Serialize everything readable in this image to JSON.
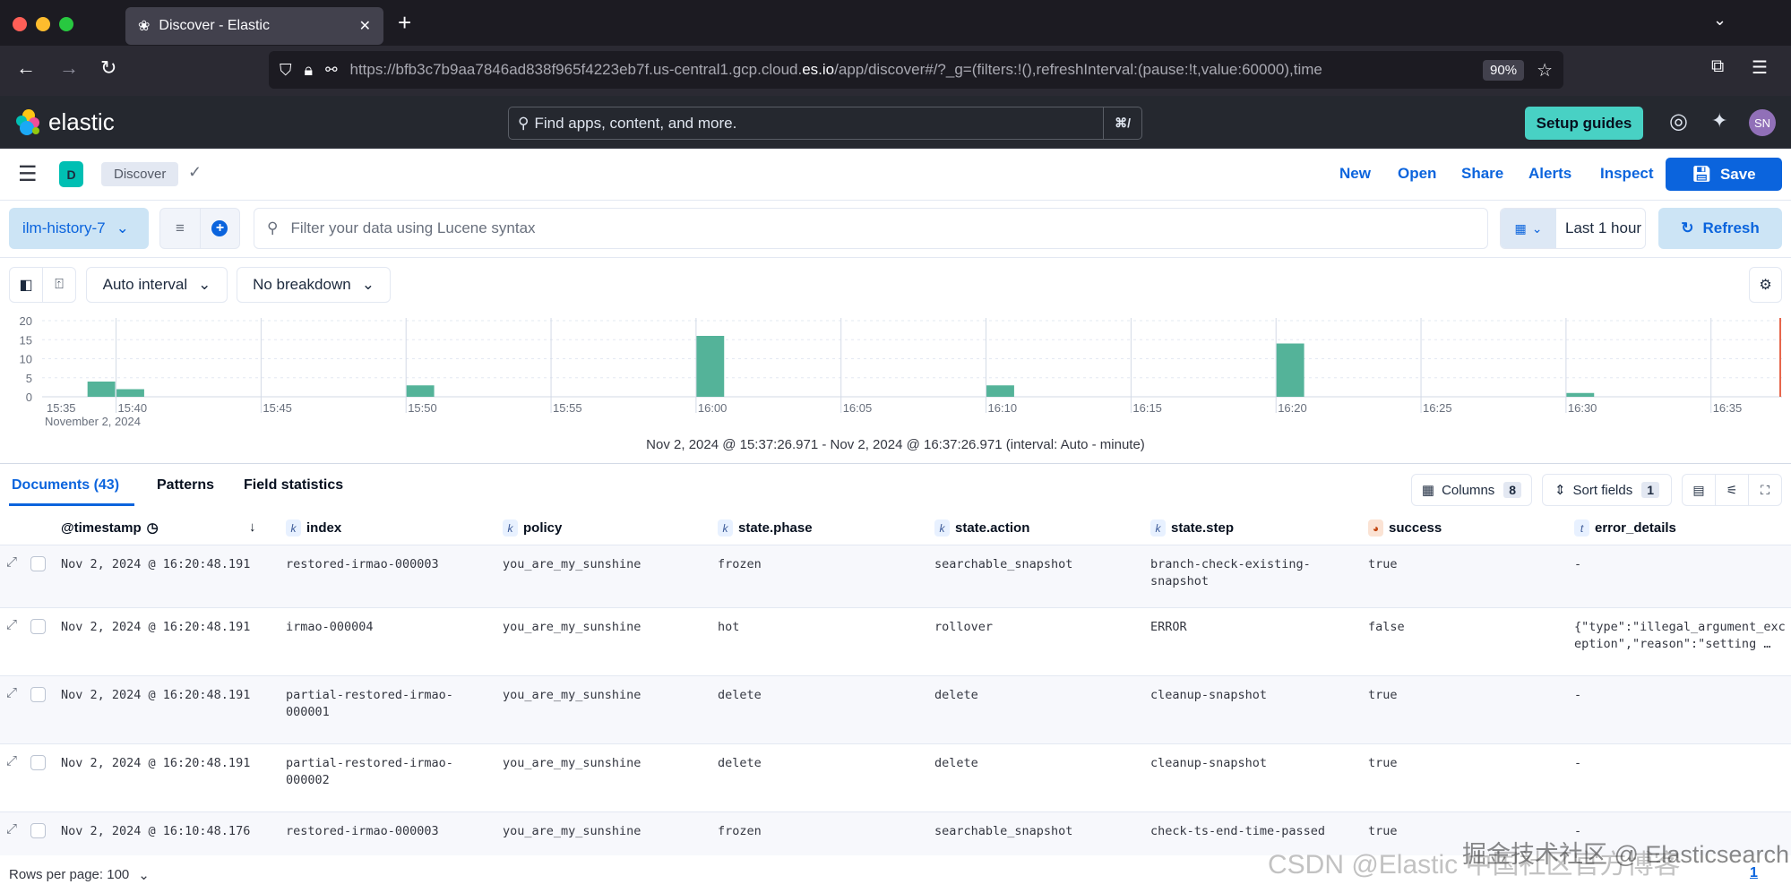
{
  "browser": {
    "tab_title": "Discover - Elastic",
    "new_tab": "+",
    "url_prefix": "https://bfb3c7b9aa7846ad838f965f4223eb7f.us-central1.gcp.cloud.",
    "url_domain": "es.io",
    "url_path": "/app/discover#/?_g=(filters:!(),refreshInterval:(pause:!t,value:60000),time",
    "zoom": "90%"
  },
  "header": {
    "logo": "elastic",
    "search_placeholder": "Find apps, content, and more.",
    "shortcut": "⌘/",
    "setup_guides": "Setup guides",
    "avatar": "SN",
    "avatar_color": "#9170b8"
  },
  "toolbar": {
    "space": "D",
    "breadcrumb": "Discover",
    "links": [
      "New",
      "Open",
      "Share",
      "Alerts",
      "Inspect"
    ],
    "save": "Save"
  },
  "query": {
    "data_view": "ilm-history-7",
    "placeholder": "Filter your data using Lucene syntax",
    "date": "Last 1 hour",
    "refresh": "Refresh"
  },
  "chart_toolbar": {
    "interval": "Auto interval",
    "breakdown": "No breakdown"
  },
  "chart_data": {
    "type": "bar",
    "x": [
      "15:39",
      "15:40",
      "15:50",
      "16:00",
      "16:10",
      "16:20",
      "16:30"
    ],
    "values": [
      4,
      2,
      3,
      16,
      3,
      14,
      1
    ],
    "x_range": [
      "15:37:26.971",
      "16:37:26.971"
    ],
    "ylim": [
      0,
      20
    ],
    "yticks": [
      0,
      5,
      10,
      15,
      20
    ],
    "xticks": [
      "15:35",
      "15:40",
      "15:45",
      "15:50",
      "15:55",
      "16:00",
      "16:05",
      "16:10",
      "16:15",
      "16:20",
      "16:25",
      "16:30",
      "16:35"
    ],
    "date_label": "November 2, 2024",
    "bar_color": "#54b399",
    "now_line_color": "#e7664c",
    "grid": true
  },
  "time_range": "Nov 2, 2024 @ 15:37:26.971 - Nov 2, 2024 @ 16:37:26.971 (interval: Auto - minute)",
  "tabs": [
    "Documents (43)",
    "Patterns",
    "Field statistics"
  ],
  "grid_controls": {
    "columns": "Columns",
    "columns_count": "8",
    "sort": "Sort fields",
    "sort_count": "1"
  },
  "columns": [
    {
      "label": "@timestamp"
    },
    {
      "type": "k",
      "label": "index"
    },
    {
      "type": "k",
      "label": "policy"
    },
    {
      "type": "k",
      "label": "state.phase"
    },
    {
      "type": "k",
      "label": "state.action"
    },
    {
      "type": "k",
      "label": "state.step"
    },
    {
      "type": "b",
      "label": "success"
    },
    {
      "type": "t",
      "label": "error_details"
    }
  ],
  "rows": [
    [
      "Nov 2, 2024 @ 16:20:48.191",
      "restored-irmao-000003",
      "you_are_my_sunshine",
      "frozen",
      "searchable_snapshot",
      "branch-check-existing-snapshot",
      "true",
      "-"
    ],
    [
      "Nov 2, 2024 @ 16:20:48.191",
      "irmao-000004",
      "you_are_my_sunshine",
      "hot",
      "rollover",
      "ERROR",
      "false",
      "{\"type\":\"illegal_argument_exception\",\"reason\":\"setting …"
    ],
    [
      "Nov 2, 2024 @ 16:20:48.191",
      "partial-restored-irmao-000001",
      "you_are_my_sunshine",
      "delete",
      "delete",
      "cleanup-snapshot",
      "true",
      "-"
    ],
    [
      "Nov 2, 2024 @ 16:20:48.191",
      "partial-restored-irmao-000002",
      "you_are_my_sunshine",
      "delete",
      "delete",
      "cleanup-snapshot",
      "true",
      "-"
    ],
    [
      "Nov 2, 2024 @ 16:10:48.176",
      "restored-irmao-000003",
      "you_are_my_sunshine",
      "frozen",
      "searchable_snapshot",
      "check-ts-end-time-passed",
      "true",
      "-"
    ]
  ],
  "footer": {
    "rows_per_page": "Rows per page: 100",
    "page": "1"
  },
  "watermark": {
    "line1": "CSDN @Elastic 中国社区官方博客",
    "line2": "掘金技术社区 @ Elasticsearch"
  }
}
